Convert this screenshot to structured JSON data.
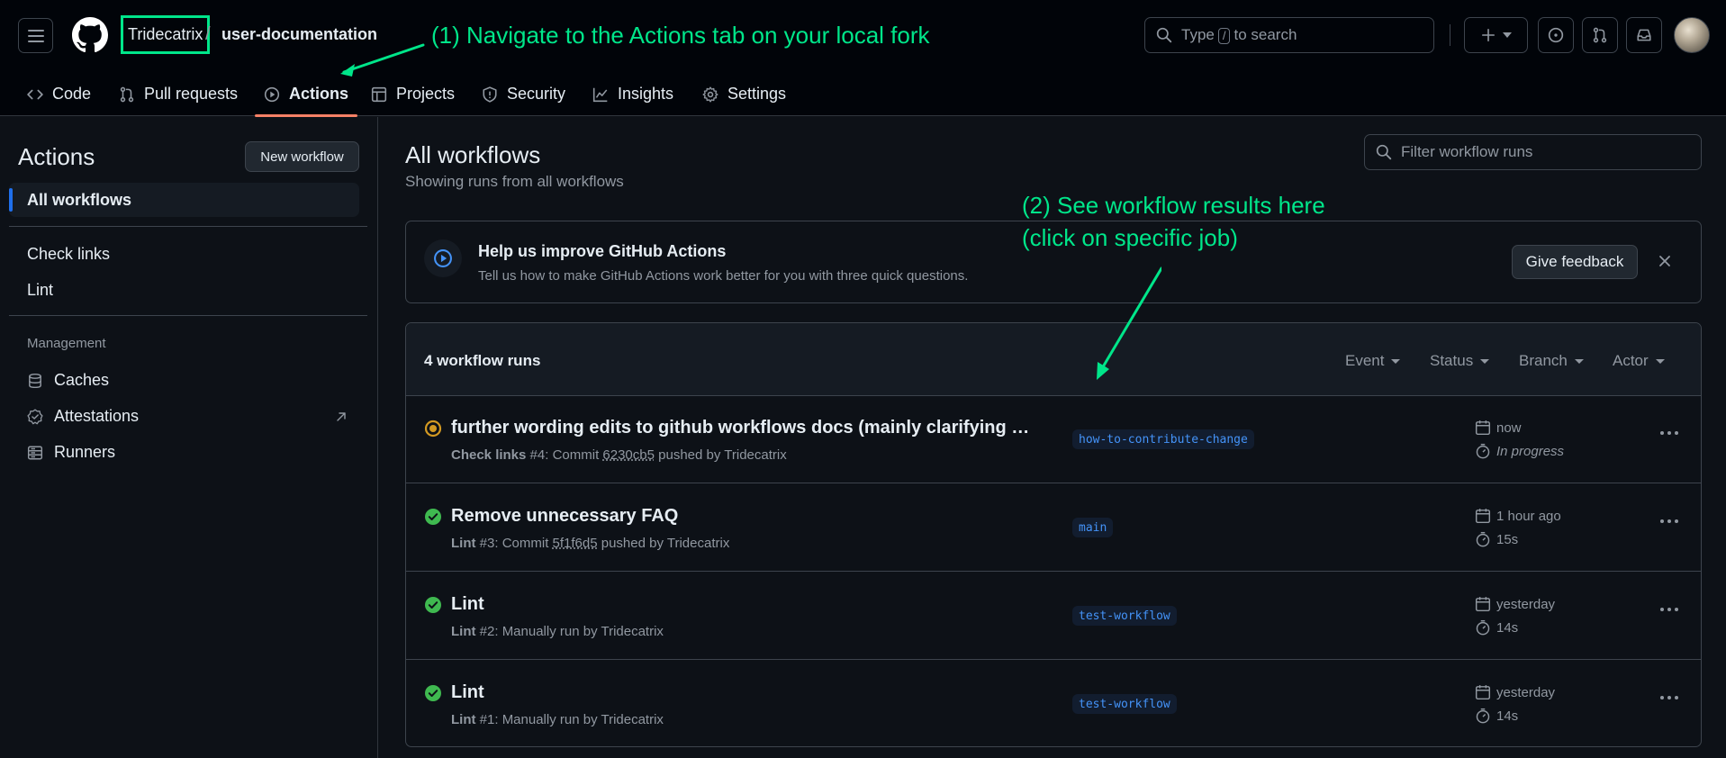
{
  "header": {
    "owner": "Tridecatrix",
    "separator": "/",
    "repo": "user-documentation",
    "search_prefix": "Type",
    "search_key": "/",
    "search_suffix": "to search"
  },
  "nav": {
    "tabs": [
      {
        "label": "Code",
        "icon": "code-icon"
      },
      {
        "label": "Pull requests",
        "icon": "pull-request-icon"
      },
      {
        "label": "Actions",
        "icon": "play-icon",
        "active": true
      },
      {
        "label": "Projects",
        "icon": "table-icon"
      },
      {
        "label": "Security",
        "icon": "shield-icon"
      },
      {
        "label": "Insights",
        "icon": "graph-icon"
      },
      {
        "label": "Settings",
        "icon": "gear-icon"
      }
    ]
  },
  "annotations": {
    "step1": "(1) Navigate to the Actions tab on your local fork",
    "step2_line1": "(2) See workflow results here",
    "step2_line2": "(click on specific job)",
    "color": "#00e68a"
  },
  "sidebar": {
    "title": "Actions",
    "new_workflow": "New workflow",
    "all_workflows": "All workflows",
    "workflows": [
      "Check links",
      "Lint"
    ],
    "management_heading": "Management",
    "management": [
      {
        "label": "Caches",
        "icon": "database-icon"
      },
      {
        "label": "Attestations",
        "icon": "verified-icon"
      },
      {
        "label": "Runners",
        "icon": "server-icon"
      }
    ]
  },
  "main": {
    "title": "All workflows",
    "subtitle": "Showing runs from all workflows",
    "filter_placeholder": "Filter workflow runs"
  },
  "feedback": {
    "title": "Help us improve GitHub Actions",
    "description": "Tell us how to make GitHub Actions work better for you with three quick questions.",
    "button": "Give feedback"
  },
  "runs": {
    "count_label": "4 workflow runs",
    "filters": [
      "Event",
      "Status",
      "Branch",
      "Actor"
    ],
    "items": [
      {
        "status": "in-progress",
        "title": "further wording edits to github workflows docs (mainly clarifying tha...",
        "workflow": "Check links",
        "run": "#4: Commit",
        "sha": "6230cb5",
        "by": "pushed by Tridecatrix",
        "branch": "how-to-contribute-change",
        "when": "now",
        "duration": "In progress"
      },
      {
        "status": "success",
        "title": "Remove unnecessary FAQ",
        "workflow": "Lint",
        "run": "#3: Commit",
        "sha": "5f1f6d5",
        "by": "pushed by Tridecatrix",
        "branch": "main",
        "when": "1 hour ago",
        "duration": "15s"
      },
      {
        "status": "success",
        "title": "Lint",
        "workflow": "Lint",
        "run": "#2: Manually run by Tridecatrix",
        "sha": "",
        "by": "",
        "branch": "test-workflow",
        "when": "yesterday",
        "duration": "14s"
      },
      {
        "status": "success",
        "title": "Lint",
        "workflow": "Lint",
        "run": "#1: Manually run by Tridecatrix",
        "sha": "",
        "by": "",
        "branch": "test-workflow",
        "when": "yesterday",
        "duration": "14s"
      }
    ]
  },
  "colors": {
    "background": "#0d1117",
    "success": "#3fb950",
    "in_progress": "#d29922",
    "accent": "#1f6feb",
    "active_tab": "#f78166"
  }
}
